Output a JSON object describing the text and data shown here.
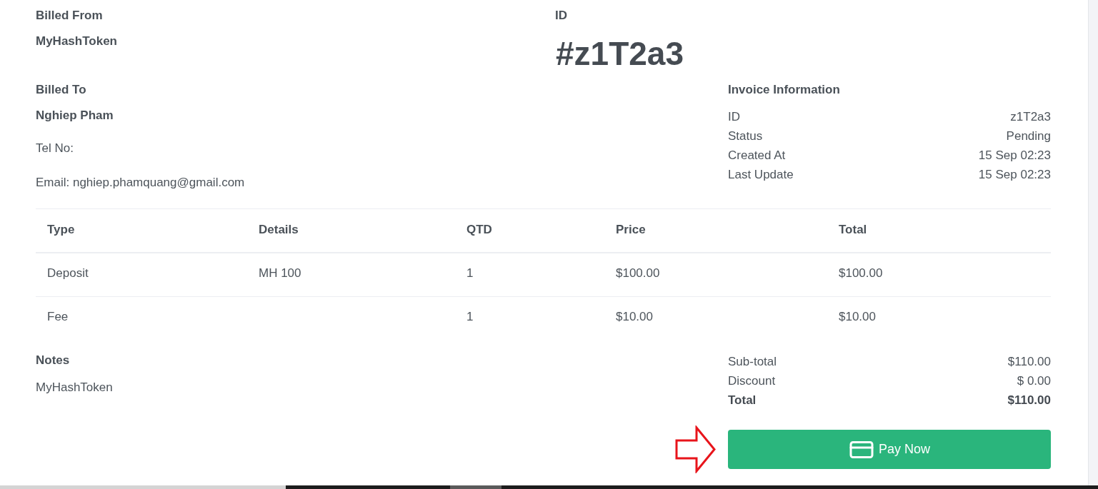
{
  "billed_from": {
    "heading": "Billed From",
    "name": "MyHashToken"
  },
  "invoice_id": {
    "heading": "ID",
    "value": "#z1T2a3"
  },
  "billed_to": {
    "heading": "Billed To",
    "name": "Nghiep Pham",
    "lines": [
      "Tel No:",
      "Email: nghiep.phamquang@gmail.com"
    ]
  },
  "invoice_information": {
    "heading": "Invoice Information",
    "rows": [
      {
        "label": "ID",
        "value": "z1T2a3"
      },
      {
        "label": "Status",
        "value": "Pending"
      },
      {
        "label": "Created At",
        "value": "15 Sep 02:23"
      },
      {
        "label": "Last Update",
        "value": "15 Sep 02:23"
      }
    ]
  },
  "table": {
    "columns": [
      "Type",
      "Details",
      "QTD",
      "Price",
      "Total"
    ],
    "rows": [
      {
        "type": "Deposit",
        "details": "MH 100",
        "qtd": "1",
        "price": "$100.00",
        "total": "$100.00"
      },
      {
        "type": "Fee",
        "qtd": "1",
        "price": "$10.00",
        "total": "$10.00"
      }
    ]
  },
  "notes": {
    "heading": "Notes",
    "text": "MyHashToken"
  },
  "totals": [
    {
      "kind": "line",
      "label": "Sub-total",
      "value": "$110.00"
    },
    {
      "kind": "line",
      "label": "Discount",
      "value": "$ 0.00"
    },
    {
      "kind": "total",
      "label": "Total",
      "value": "$110.00"
    }
  ],
  "pay_button": {
    "label": "Pay Now"
  }
}
